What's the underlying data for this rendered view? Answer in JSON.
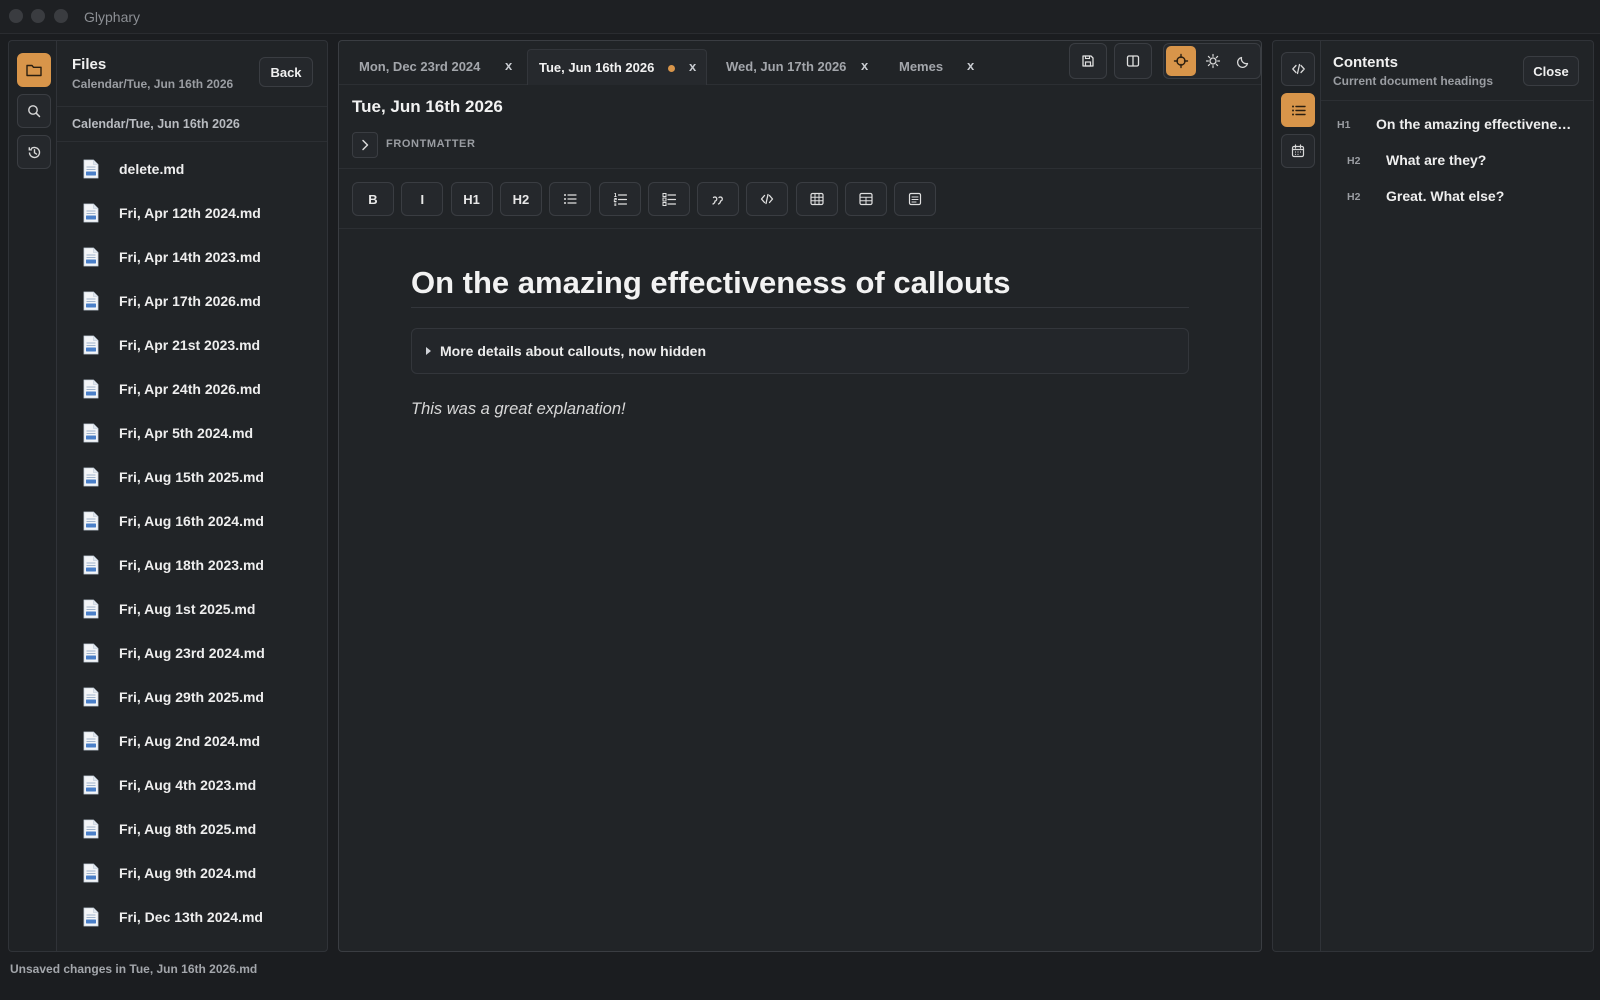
{
  "app": {
    "title": "Glyphary"
  },
  "left_rail": {
    "items": [
      {
        "icon": "folder-icon",
        "active": true
      },
      {
        "icon": "search-icon",
        "active": false
      },
      {
        "icon": "history-icon",
        "active": false
      }
    ]
  },
  "files": {
    "title": "Files",
    "subtitle": "Calendar/Tue, Jun 16th 2026",
    "back_label": "Back",
    "path": "Calendar/Tue, Jun 16th 2026",
    "items": [
      "delete.md",
      "Fri, Apr 12th 2024.md",
      "Fri, Apr 14th 2023.md",
      "Fri, Apr 17th 2026.md",
      "Fri, Apr 21st 2023.md",
      "Fri, Apr 24th 2026.md",
      "Fri, Apr 5th 2024.md",
      "Fri, Aug 15th 2025.md",
      "Fri, Aug 16th 2024.md",
      "Fri, Aug 18th 2023.md",
      "Fri, Aug 1st 2025.md",
      "Fri, Aug 23rd 2024.md",
      "Fri, Aug 29th 2025.md",
      "Fri, Aug 2nd 2024.md",
      "Fri, Aug 4th 2023.md",
      "Fri, Aug 8th 2025.md",
      "Fri, Aug 9th 2024.md",
      "Fri, Dec 13th 2024.md"
    ]
  },
  "tabs": [
    {
      "label": "Mon, Dec 23rd 2024",
      "close": "x",
      "active": false,
      "unsaved": false
    },
    {
      "label": "Tue, Jun 16th 2026",
      "close": "x",
      "active": true,
      "unsaved": true
    },
    {
      "label": "Wed, Jun 17th 2026",
      "close": "x",
      "active": false,
      "unsaved": false
    },
    {
      "label": "Memes",
      "close": "x",
      "active": false,
      "unsaved": false
    }
  ],
  "toolbar": {
    "buttons": [
      "save-icon",
      "split-view-icon"
    ],
    "theme_modes": [
      {
        "icon": "auto-theme-icon",
        "active": true
      },
      {
        "icon": "sun-icon",
        "active": false
      },
      {
        "icon": "moon-icon",
        "active": false
      }
    ]
  },
  "document": {
    "title": "Tue, Jun 16th 2026",
    "frontmatter_label": "FRONTMATTER",
    "format_buttons": [
      {
        "label": "B",
        "icon": null
      },
      {
        "label": "I",
        "icon": null
      },
      {
        "label": "H1",
        "icon": null
      },
      {
        "label": "H2",
        "icon": null
      },
      {
        "label": "",
        "icon": "bullet-list-icon"
      },
      {
        "label": "",
        "icon": "numbered-list-icon"
      },
      {
        "label": "",
        "icon": "checklist-icon"
      },
      {
        "label": "",
        "icon": "quote-icon"
      },
      {
        "label": "",
        "icon": "code-icon"
      },
      {
        "label": "",
        "icon": "table-icon"
      },
      {
        "label": "",
        "icon": "table-header-icon"
      },
      {
        "label": "",
        "icon": "callout-icon"
      }
    ],
    "heading": "On the amazing effectiveness of callouts",
    "callout_summary": "More details about callouts, now hidden",
    "paragraph": "This was a great explanation!"
  },
  "right_rail": {
    "items": [
      {
        "icon": "code-icon",
        "active": false
      },
      {
        "icon": "list-icon",
        "active": true
      },
      {
        "icon": "calendar-icon",
        "active": false
      }
    ]
  },
  "contents": {
    "title": "Contents",
    "subtitle": "Current document headings",
    "close_label": "Close",
    "headings": [
      {
        "level": "H1",
        "text": "On the amazing effectiveness of callouts"
      },
      {
        "level": "H2",
        "text": "What are they?"
      },
      {
        "level": "H2",
        "text": "Great. What else?"
      }
    ]
  },
  "status": {
    "text": "Unsaved changes in Tue, Jun 16th 2026.md"
  },
  "colors": {
    "accent": "#d8954a",
    "background": "#1b1d20",
    "panel": "#212427"
  }
}
